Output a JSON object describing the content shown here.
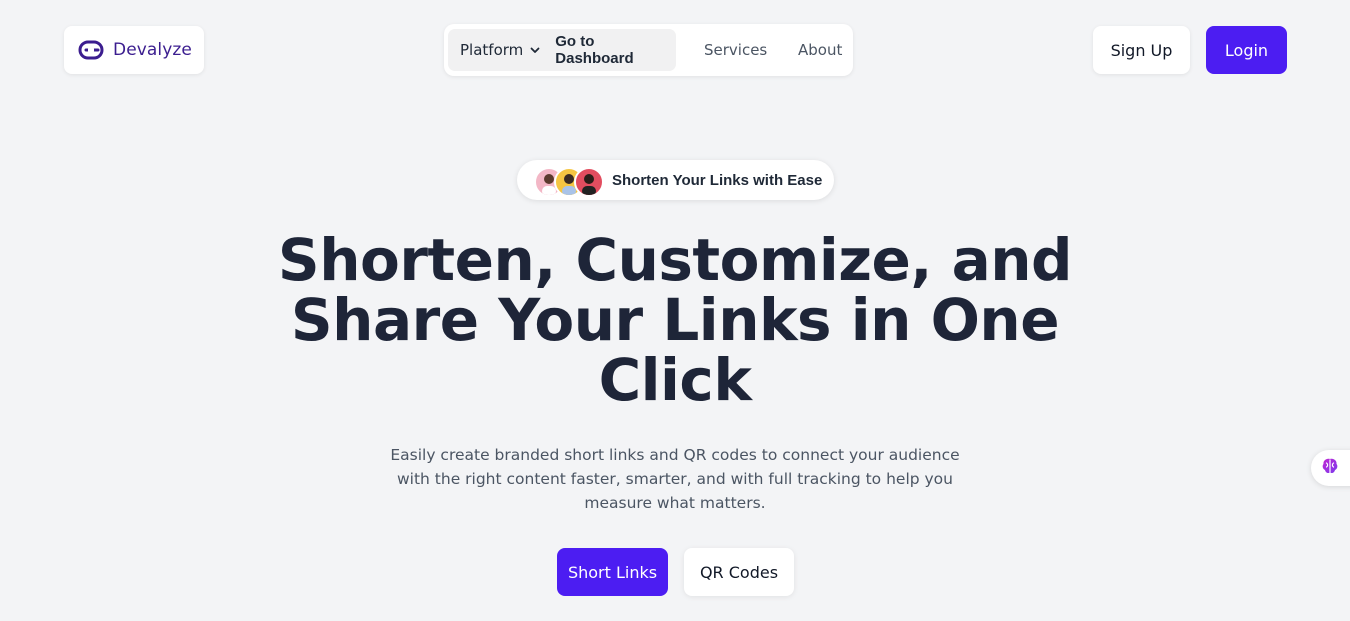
{
  "brand": {
    "name": "Devalyze",
    "icon": "link-icon",
    "color": "#3b1d8f"
  },
  "nav": {
    "platform_label": "Platform",
    "dashboard_label": "Go to Dashboard",
    "services_label": "Services",
    "about_label": "About"
  },
  "auth": {
    "signup_label": "Sign Up",
    "login_label": "Login"
  },
  "hero": {
    "badge_text": "Shorten Your Links with Ease",
    "headline_line1": "Shorten, Customize, and",
    "headline_line2": "Share Your Links in One",
    "headline_line3": "Click",
    "subtext": "Easily create branded short links and QR codes to connect your audience with the right content faster, smarter, and with full tracking to help you measure what matters.",
    "primary_cta": "Short Links",
    "secondary_cta": "QR Codes"
  },
  "colors": {
    "accent": "#4c1df2",
    "background": "#f3f4f6",
    "heading": "#1e2538"
  },
  "side_widget": {
    "icon": "brain-icon"
  }
}
